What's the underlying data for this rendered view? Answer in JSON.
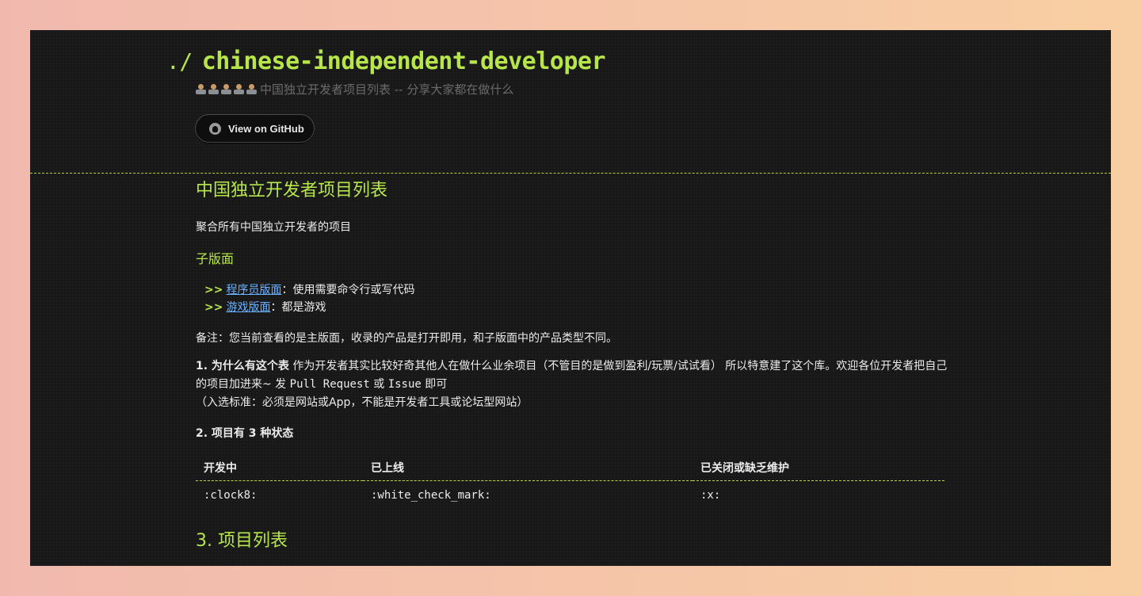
{
  "header": {
    "prefix": "./",
    "title": "chinese-independent-developer",
    "subtitle": "中国独立开发者项目列表 -- 分享大家都在做什么",
    "emoji_icons": [
      "technologist-icon",
      "technologist-icon",
      "technologist-icon",
      "technologist-icon",
      "technologist-icon"
    ],
    "github_button": "View on GitHub"
  },
  "main": {
    "heading": "中国独立开发者项目列表",
    "intro": "聚合所有中国独立开发者的项目",
    "sub_heading": "子版面",
    "sub_items": [
      {
        "arrow": ">>",
        "link": "程序员版面",
        "desc": "：使用需要命令行或写代码"
      },
      {
        "arrow": ">>",
        "link": "游戏版面",
        "desc": "：都是游戏"
      }
    ],
    "note": "备注：您当前查看的是主版面，收录的产品是打开即用，和子版面中的产品类型不同。",
    "why_title": "1. 为什么有这个表",
    "why_body_1": " 作为开发者其实比较好奇其他人在做什么业余项目（不管目的是做到盈利/玩票/试试看） 所以特意建了这个库。欢迎各位开发者把自己的项目加进来~ 发 ",
    "why_pr": "Pull Request",
    "why_or": " 或 ",
    "why_issue": "Issue",
    "why_end": " 即可",
    "why_criteria": "（入选标准：必须是网站或App，不能是开发者工具或论坛型网站）",
    "states_heading": "2. 项目有 3 种状态",
    "states_table": {
      "headers": [
        "开发中",
        "已上线",
        "已关闭或缺乏维护"
      ],
      "row": [
        ":clock8:",
        ":white_check_mark:",
        ":x:"
      ]
    },
    "list_heading": "3. 项目列表"
  },
  "colors": {
    "accent": "#b6e64a",
    "link": "#6cb2ff",
    "background": "#181818"
  }
}
